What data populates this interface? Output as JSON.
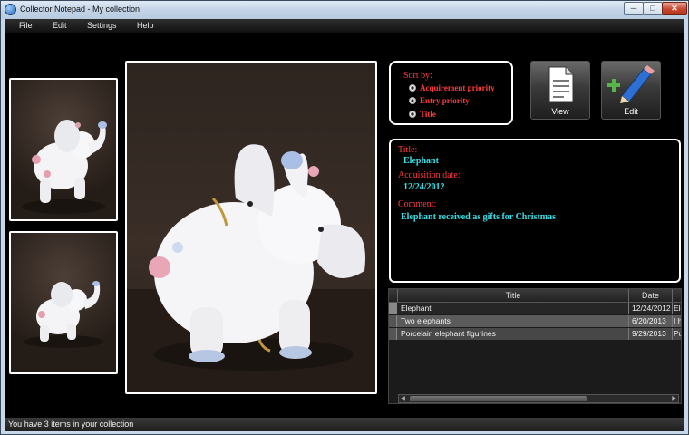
{
  "window": {
    "title": "Collector Notepad - My collection"
  },
  "menu": {
    "items": [
      "File",
      "Edit",
      "Settings",
      "Help"
    ]
  },
  "sort": {
    "title": "Sort by:",
    "options": [
      "Acquirement priority",
      "Entry priority",
      "Title"
    ],
    "selected": "Entry priority"
  },
  "toolbar": {
    "view_label": "View",
    "edit_label": "Edit"
  },
  "details": {
    "title_label": "Title:",
    "title_value": "Elephant",
    "date_label": "Acquisition date:",
    "date_value": "12/24/2012",
    "comment_label": "Comment:",
    "comment_value": "Elephant received as gifts for Christmas"
  },
  "table": {
    "columns": [
      "Title",
      "Date"
    ],
    "rows": [
      {
        "title": "Elephant",
        "date": "12/24/2012",
        "extra": "Ele"
      },
      {
        "title": "Two elephants",
        "date": "6/20/2013",
        "extra": "I h"
      },
      {
        "title": "Porcelain elephant figurines",
        "date": "9/29/2013",
        "extra": "Pu"
      }
    ]
  },
  "status": {
    "text": "You have 3 items in your collection"
  },
  "colors": {
    "label_red": "#ff3b3b",
    "value_cyan": "#38e0e8",
    "background": "#000000"
  }
}
